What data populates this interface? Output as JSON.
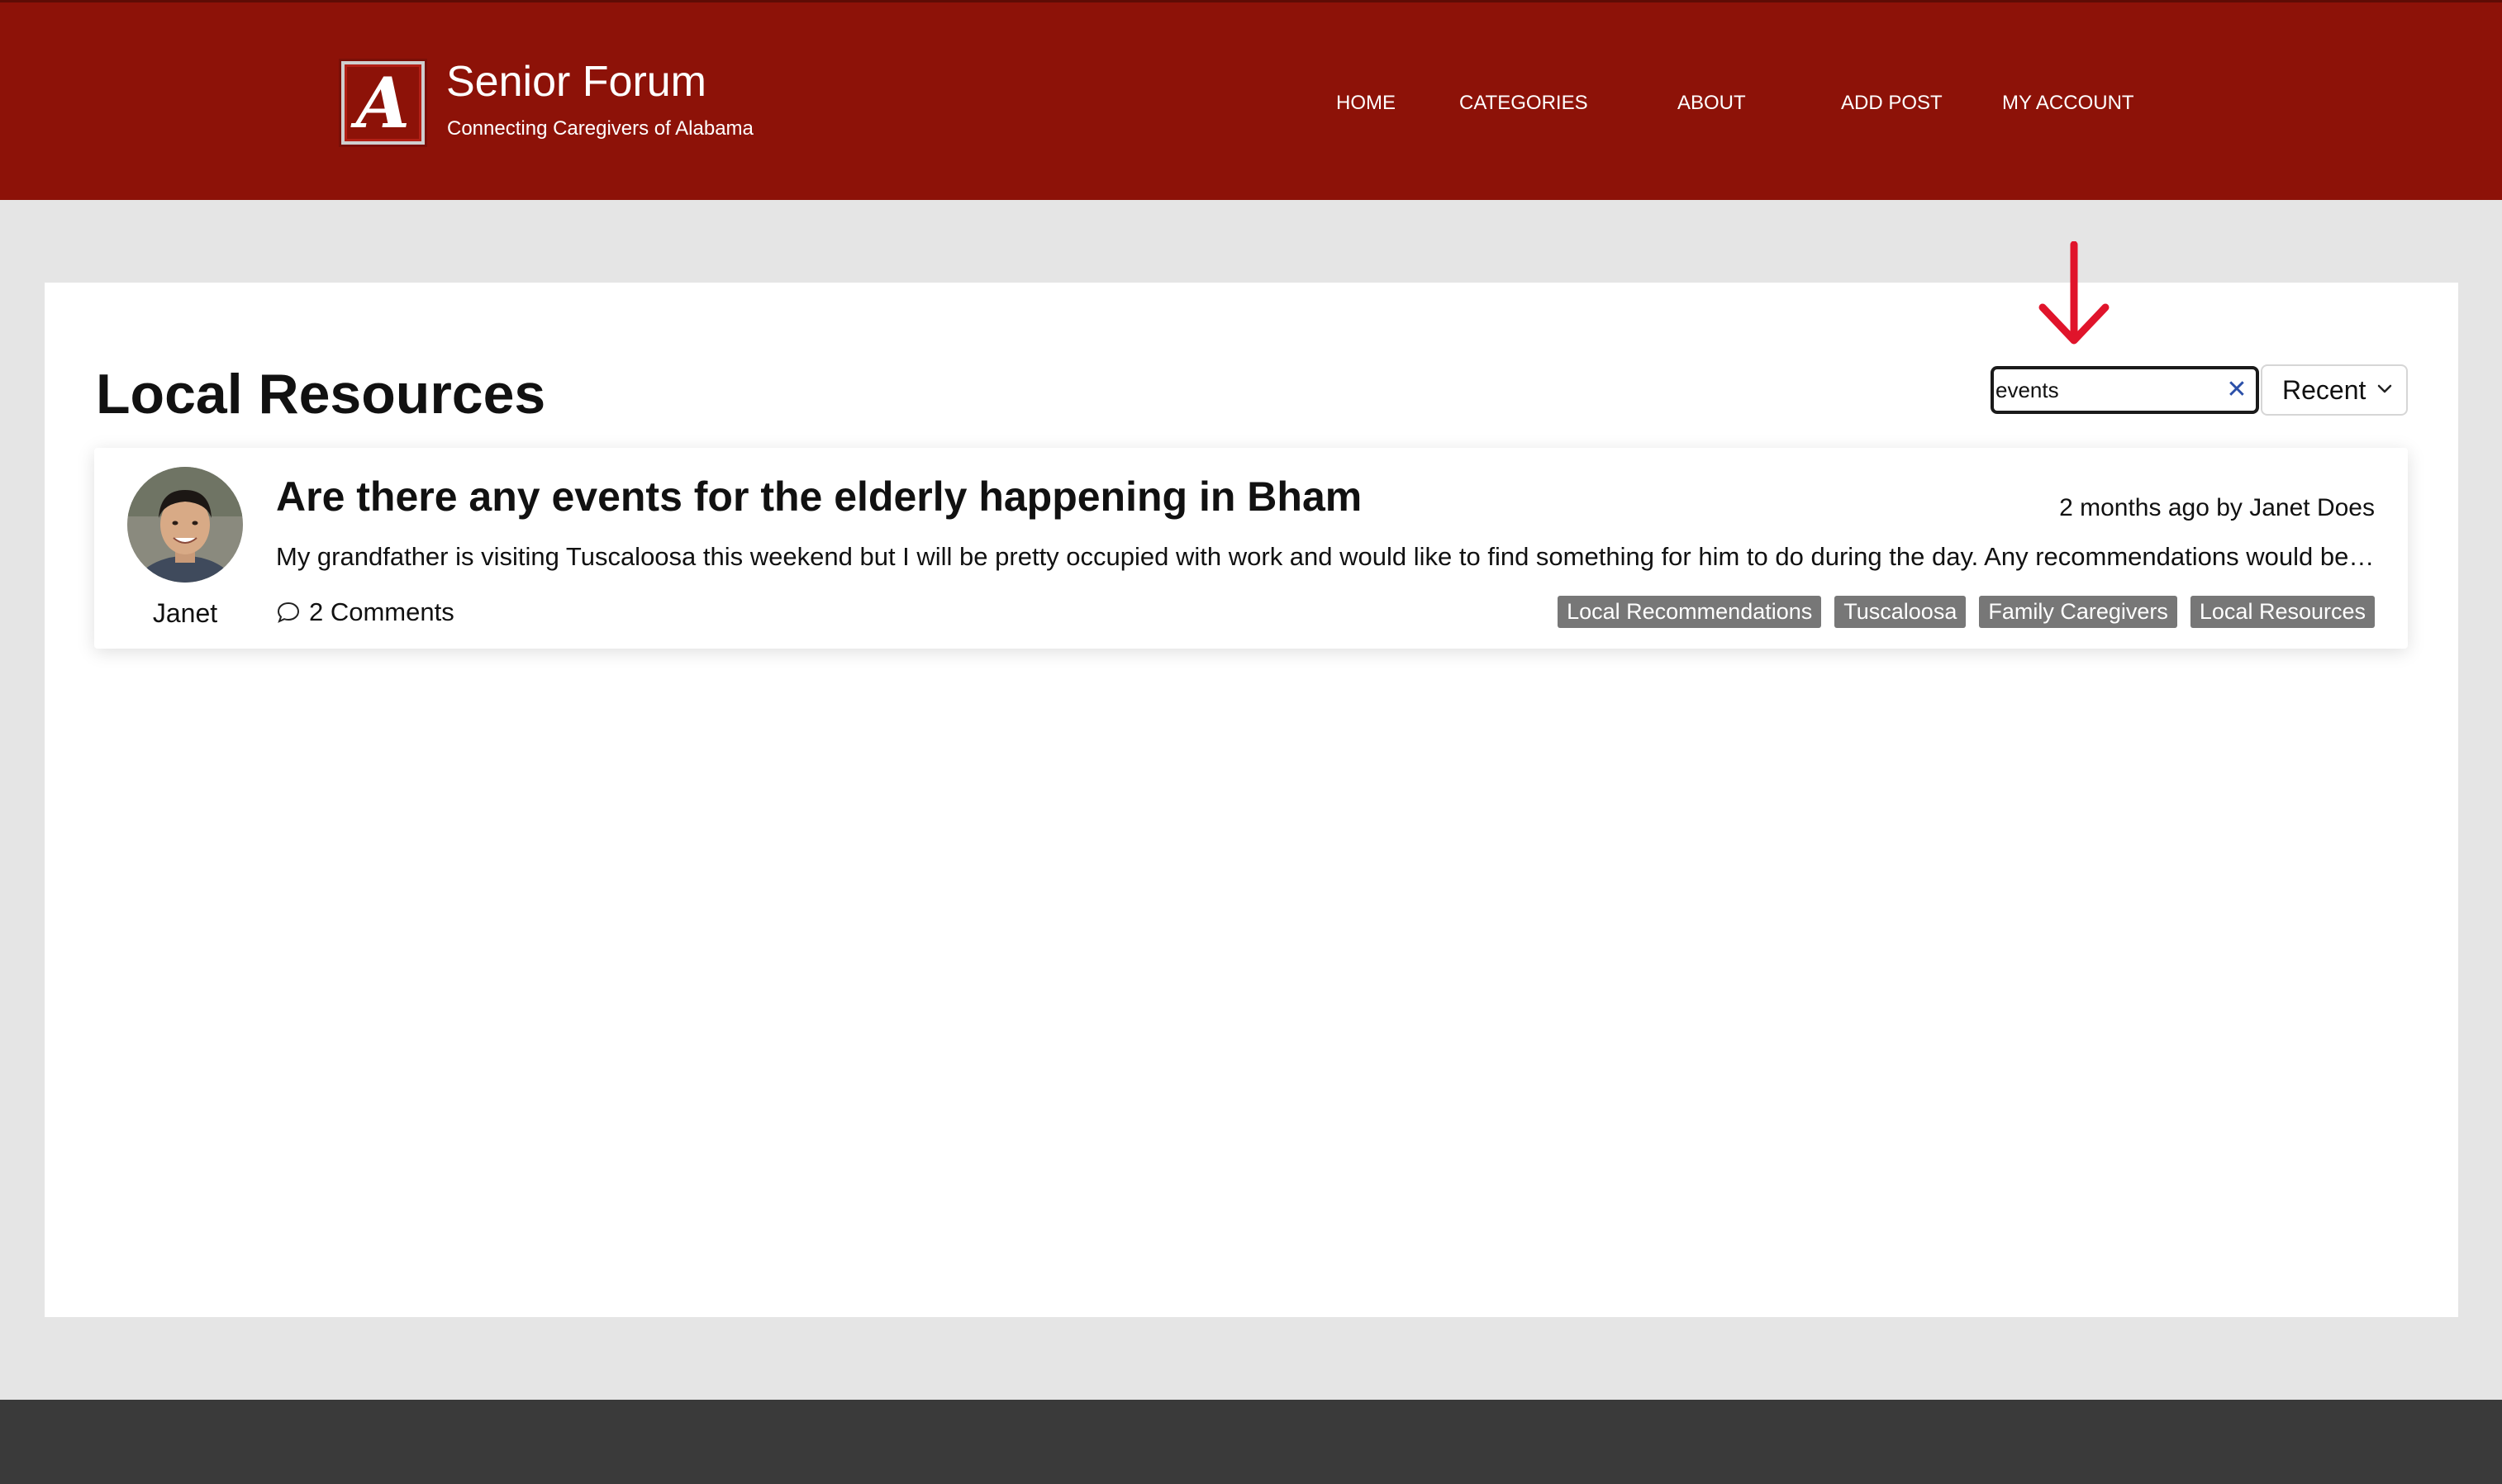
{
  "site": {
    "logo_letter": "A",
    "title": "Senior Forum",
    "subtitle": "Connecting Caregivers of Alabama"
  },
  "nav": {
    "items": [
      "HOME",
      "CATEGORIES",
      "ABOUT",
      "ADD POST",
      "MY ACCOUNT"
    ]
  },
  "page": {
    "title": "Local Resources"
  },
  "search": {
    "value": "events"
  },
  "sort": {
    "selected": "Recent"
  },
  "post": {
    "author": "Janet",
    "title": "Are there any events for the elderly happening in Bham",
    "meta": "2 months ago by Janet Does",
    "excerpt": "My grandfather is visiting Tuscaloosa this weekend but I will be pretty occupied with work and would like to find something for him to do during the day. Any recommendations would be appreciated",
    "comments": "2 Comments",
    "tags": [
      "Local Recommendations",
      "Tuscaloosa",
      "Family Caregivers",
      "Local Resources"
    ]
  },
  "colors": {
    "brand": "#8d1208",
    "annotation_arrow": "#e0142b",
    "tag_bg": "#777777",
    "footer": "#3a3a3a"
  }
}
